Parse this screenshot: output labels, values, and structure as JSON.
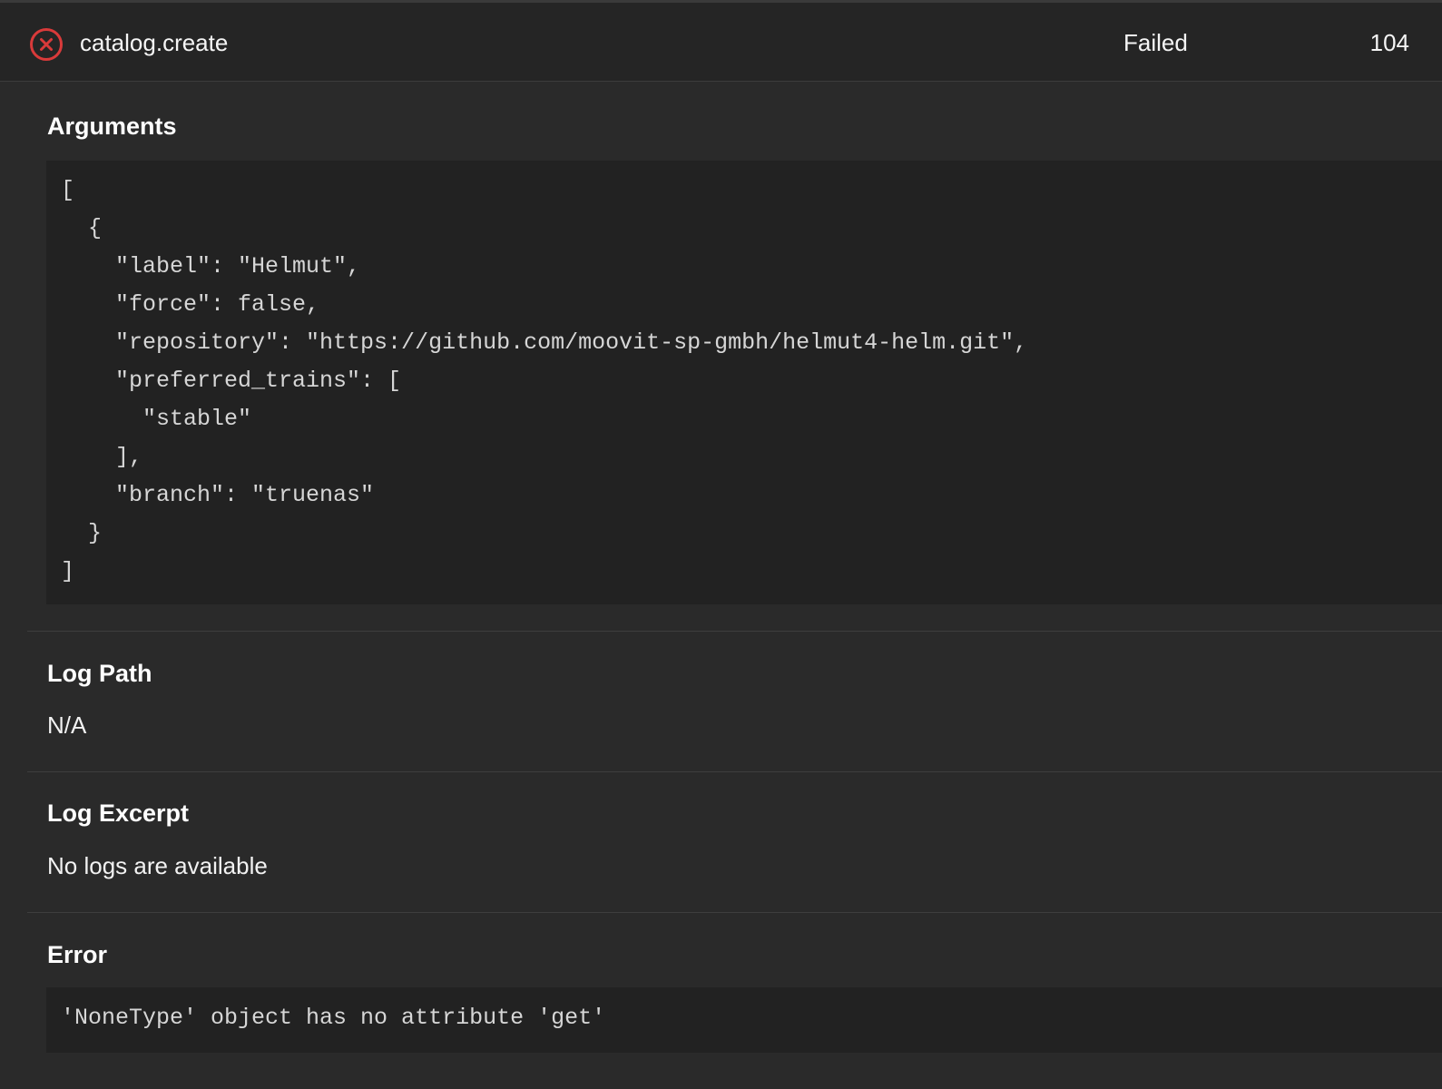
{
  "job": {
    "status_icon": "error-circle-x-icon",
    "name": "catalog.create",
    "state": "Failed",
    "id": "104"
  },
  "colors": {
    "error_red": "#d93a3a",
    "background": "#2a2a2a",
    "code_background": "#222222"
  },
  "arguments": {
    "title": "Arguments",
    "lines": [
      "[",
      "  {",
      "    \"label\": \"Helmut\",",
      "    \"force\": false,",
      "    \"repository\": \"https://github.com/moovit-sp-gmbh/helmut4-helm.git\",",
      "    \"preferred_trains\": [",
      "      \"stable\"",
      "    ],",
      "    \"branch\": \"truenas\"",
      "  }",
      "]"
    ]
  },
  "log_path": {
    "title": "Log Path",
    "value": "N/A"
  },
  "log_excerpt": {
    "title": "Log Excerpt",
    "value": "No logs are available"
  },
  "error": {
    "title": "Error",
    "message": "'NoneType' object has no attribute 'get'"
  }
}
